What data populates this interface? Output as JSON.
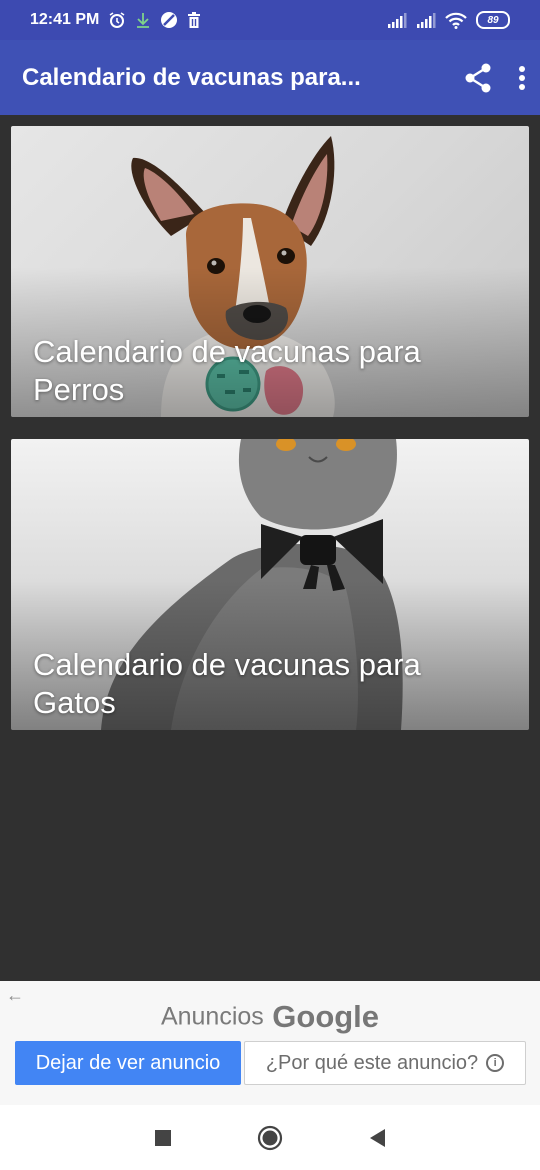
{
  "status_bar": {
    "time": "12:41 PM",
    "icons": [
      "alarm-icon",
      "download-icon",
      "blocked-icon",
      "trash-icon",
      "signal-icon",
      "signal-icon",
      "wifi-icon"
    ],
    "battery": "89"
  },
  "app_bar": {
    "title": "Calendario de vacunas para...",
    "actions": [
      "share-icon",
      "more-vert-icon"
    ]
  },
  "cards": [
    {
      "title": "Calendario de vacunas para Perros"
    },
    {
      "title": "Calendario de vacunas para Gatos"
    }
  ],
  "ad": {
    "label": "Anuncios",
    "brand": "Google",
    "stop_button": "Dejar de ver anuncio",
    "why_button": "¿Por qué este anuncio?",
    "info_glyph": "i"
  },
  "nav_bar": {
    "buttons": [
      "recents-icon",
      "home-icon",
      "back-icon"
    ]
  },
  "colors": {
    "primary": "#3f51b5",
    "status_bar": "#3d4ab1",
    "background": "#303030",
    "ad_button": "#4285f4"
  }
}
